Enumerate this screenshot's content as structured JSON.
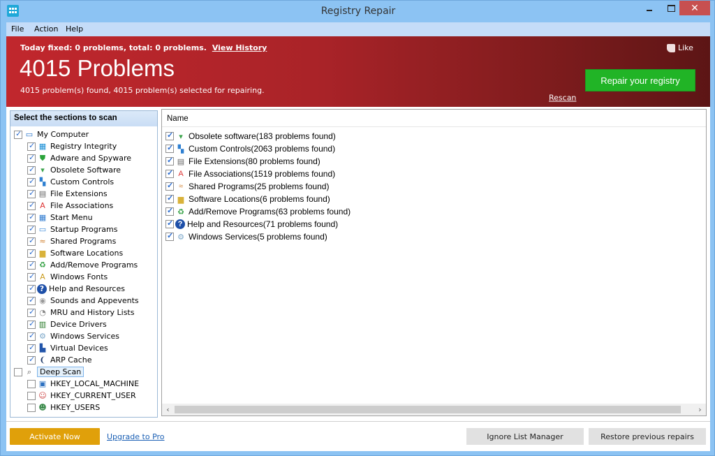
{
  "window": {
    "title": "Registry Repair",
    "controls": {
      "minimize": "minimize",
      "maximize": "maximize",
      "close": "✕"
    }
  },
  "menu": [
    "File",
    "Action",
    "Help"
  ],
  "banner": {
    "today_text": "Today fixed: 0 problems, total: 0 problems.",
    "view_history": "View History",
    "headline": "4015 Problems",
    "summary": "4015 problem(s) found, 4015 problem(s) selected for repairing.",
    "like": "Like",
    "rescan": "Rescan",
    "repair_button": "Repair your registry",
    "colors": {
      "banner": "#b02428",
      "repair": "#21b426"
    }
  },
  "sections": {
    "header": "Select the sections to scan",
    "groups": [
      {
        "label": "My Computer",
        "checked": true,
        "icon": "monitor-icon",
        "items": [
          {
            "label": "Registry Integrity",
            "checked": true,
            "icon": "registry-icon"
          },
          {
            "label": "Adware and Spyware",
            "checked": true,
            "icon": "shield-icon"
          },
          {
            "label": "Obsolete Software",
            "checked": true,
            "icon": "trash-icon"
          },
          {
            "label": "Custom Controls",
            "checked": true,
            "icon": "blocks-icon"
          },
          {
            "label": "File Extensions",
            "checked": true,
            "icon": "document-icon"
          },
          {
            "label": "File Associations",
            "checked": true,
            "icon": "font-a-icon"
          },
          {
            "label": "Start Menu",
            "checked": true,
            "icon": "start-menu-icon"
          },
          {
            "label": "Startup Programs",
            "checked": true,
            "icon": "window-icon"
          },
          {
            "label": "Shared Programs",
            "checked": true,
            "icon": "handshake-icon"
          },
          {
            "label": "Software Locations",
            "checked": true,
            "icon": "folder-icon"
          },
          {
            "label": "Add/Remove Programs",
            "checked": true,
            "icon": "recycle-icon"
          },
          {
            "label": "Windows Fonts",
            "checked": true,
            "icon": "fonts-folder-icon"
          },
          {
            "label": "Help and Resources",
            "checked": true,
            "icon": "help-icon"
          },
          {
            "label": "Sounds and Appevents",
            "checked": true,
            "icon": "speaker-icon"
          },
          {
            "label": "MRU and History Lists",
            "checked": true,
            "icon": "clock-icon"
          },
          {
            "label": "Device Drivers",
            "checked": true,
            "icon": "chip-icon"
          },
          {
            "label": "Windows Services",
            "checked": true,
            "icon": "services-icon"
          },
          {
            "label": "Virtual Devices",
            "checked": true,
            "icon": "virtual-device-icon"
          },
          {
            "label": "ARP Cache",
            "checked": true,
            "icon": "footprints-icon"
          }
        ]
      },
      {
        "label": "Deep Scan",
        "checked": false,
        "icon": "magnifier-icon",
        "items": [
          {
            "label": "HKEY_LOCAL_MACHINE",
            "checked": false,
            "icon": "computers-icon"
          },
          {
            "label": "HKEY_CURRENT_USER",
            "checked": false,
            "icon": "user-icon"
          },
          {
            "label": "HKEY_USERS",
            "checked": false,
            "icon": "users-icon"
          }
        ]
      }
    ]
  },
  "results": {
    "column": "Name",
    "rows": [
      {
        "label": "Obsolete software(183 problems found)",
        "checked": true,
        "icon": "trash-icon"
      },
      {
        "label": "Custom Controls(2063 problems found)",
        "checked": true,
        "icon": "blocks-icon"
      },
      {
        "label": "File Extensions(80 problems found)",
        "checked": true,
        "icon": "document-icon"
      },
      {
        "label": "File Associations(1519 problems found)",
        "checked": true,
        "icon": "font-a-icon"
      },
      {
        "label": "Shared Programs(25 problems found)",
        "checked": true,
        "icon": "handshake-icon"
      },
      {
        "label": "Software Locations(6 problems found)",
        "checked": true,
        "icon": "folder-icon"
      },
      {
        "label": "Add/Remove Programs(63 problems found)",
        "checked": true,
        "icon": "recycle-icon"
      },
      {
        "label": "Help and Resources(71 problems found)",
        "checked": true,
        "icon": "help-icon"
      },
      {
        "label": "Windows Services(5 problems found)",
        "checked": true,
        "icon": "services-icon"
      }
    ]
  },
  "footer": {
    "activate": "Activate Now",
    "upgrade": "Upgrade to Pro",
    "ignore": "Ignore List Manager",
    "restore": "Restore previous repairs",
    "colors": {
      "activate": "#e0a00a"
    }
  }
}
